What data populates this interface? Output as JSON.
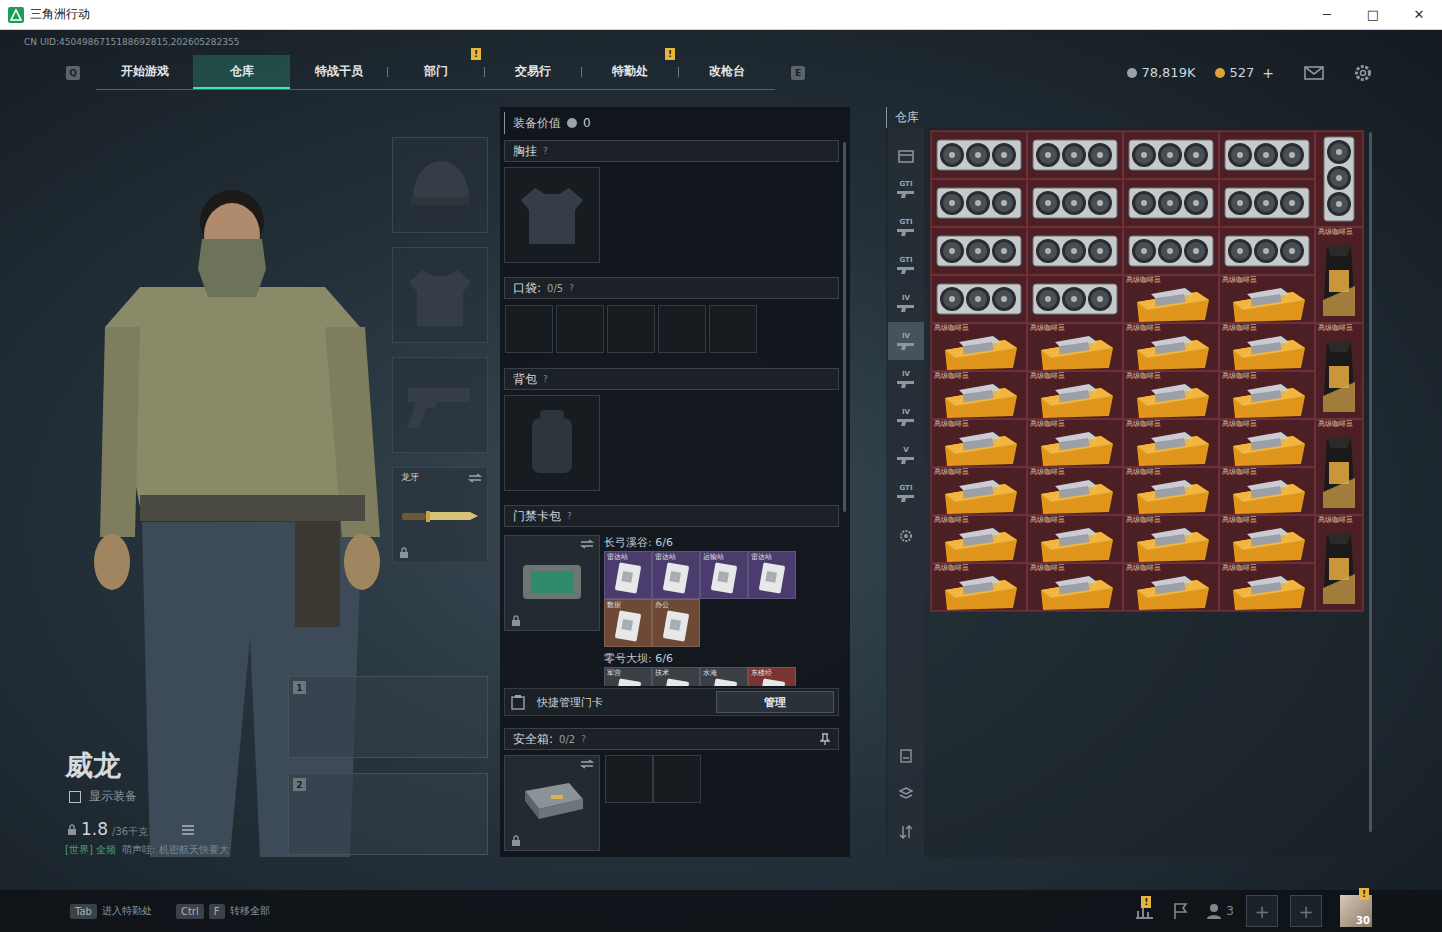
{
  "window": {
    "title": "三角洲行动",
    "controls": [
      "─",
      "□",
      "✕"
    ]
  },
  "uid": "CN UID:4504986715188692815,202605282355",
  "nav": {
    "prev_key": "Q",
    "next_key": "E",
    "tabs": [
      {
        "label": "开始游戏",
        "selected": false,
        "badge": ""
      },
      {
        "label": "仓库",
        "selected": true,
        "badge": ""
      },
      {
        "label": "特战干员",
        "selected": false,
        "badge": ""
      },
      {
        "label": "部门",
        "selected": false,
        "badge": "!"
      },
      {
        "label": "交易行",
        "selected": false,
        "badge": ""
      },
      {
        "label": "特勤处",
        "selected": false,
        "badge": "!"
      },
      {
        "label": "改枪台",
        "selected": false,
        "badge": ""
      }
    ],
    "currencies": [
      {
        "value": "78,819K",
        "add": "",
        "color": "#9aa3aa"
      },
      {
        "value": "527",
        "add": "+",
        "color": "#d9a53a"
      }
    ]
  },
  "character": {
    "name": "威龙",
    "show_equipment": {
      "label": "显示装备",
      "checked": false
    },
    "weight": {
      "value": "1.8",
      "max": "/36千克"
    },
    "chat": {
      "channel": "[世界] 全频",
      "message": "萌声哇: 机密航天快要大"
    }
  },
  "gear_slots": [
    {
      "kind": "helmet",
      "label": "",
      "locked": false
    },
    {
      "kind": "armor",
      "label": "",
      "locked": false
    },
    {
      "kind": "pistol",
      "label": "",
      "locked": false
    },
    {
      "kind": "melee",
      "label": "龙牙",
      "locked": true
    }
  ],
  "weapon_slots": [
    {
      "number": "1"
    },
    {
      "number": "2"
    }
  ],
  "loadout": {
    "value_label": "装备价值",
    "value": "0",
    "chest": {
      "label": "胸挂",
      "help": "?"
    },
    "pockets": {
      "label": "口袋:",
      "count": "0/5",
      "help": "?",
      "slots": 5
    },
    "backpack": {
      "label": "背包",
      "help": "?"
    },
    "keycards": {
      "label": "门禁卡包",
      "help": "?",
      "locked": true,
      "groups": [
        {
          "title": "长弓溪谷: 6/6",
          "cards": [
            {
              "label": "雷达站",
              "color": "#4b3c6e"
            },
            {
              "label": "雷达站",
              "color": "#4b3c6e"
            },
            {
              "label": "运输站",
              "color": "#4b3c6e"
            },
            {
              "label": "雷达站",
              "color": "#4b3c6e"
            },
            {
              "label": "数据",
              "color": "#6e4a36"
            },
            {
              "label": "办公",
              "color": "#6e4a36"
            }
          ]
        },
        {
          "title": "零号大坝: 6/6",
          "cards": [
            {
              "label": "军营",
              "color": "#3a3f46"
            },
            {
              "label": "技术",
              "color": "#3a3f46"
            },
            {
              "label": "水淹",
              "color": "#3a3f46"
            },
            {
              "label": "东楼经",
              "color": "#7a3434"
            }
          ]
        }
      ],
      "quick": {
        "label": "快捷管理门卡",
        "button": "管理"
      }
    },
    "safe": {
      "label": "安全箱:",
      "count": "0/2",
      "help": "?",
      "locked": true,
      "slots": 2
    }
  },
  "warehouse": {
    "title": "仓库",
    "tabs": [
      {
        "kind": "box",
        "label": "",
        "selected": false
      },
      {
        "kind": "gun",
        "label": "GTI",
        "selected": false
      },
      {
        "kind": "gun",
        "label": "GTI",
        "selected": false
      },
      {
        "kind": "gun",
        "label": "GTI",
        "selected": false
      },
      {
        "kind": "gun",
        "label": "IV",
        "selected": false
      },
      {
        "kind": "gun",
        "label": "IV",
        "selected": true
      },
      {
        "kind": "gun",
        "label": "IV",
        "selected": false
      },
      {
        "kind": "gun",
        "label": "IV",
        "selected": false
      },
      {
        "kind": "gun",
        "label": "V",
        "selected": false
      },
      {
        "kind": "gun",
        "label": "GTI",
        "selected": false
      },
      {
        "kind": "gear",
        "label": "",
        "selected": false
      }
    ],
    "bottom_tabs": [
      {
        "kind": "sort",
        "selected": false
      },
      {
        "kind": "layers",
        "selected": false
      },
      {
        "kind": "transfer",
        "selected": false
      }
    ],
    "items": [
      {
        "kind": "gpu",
        "label": ""
      },
      {
        "kind": "gpu",
        "label": ""
      },
      {
        "kind": "gpu",
        "label": ""
      },
      {
        "kind": "gpu",
        "label": ""
      },
      {
        "kind": "gpu-vertical",
        "label": ""
      },
      {
        "kind": "gpu",
        "label": ""
      },
      {
        "kind": "gpu",
        "label": ""
      },
      {
        "kind": "gpu",
        "label": ""
      },
      {
        "kind": "gpu",
        "label": ""
      },
      {
        "kind": "gpu",
        "label": ""
      },
      {
        "kind": "gpu",
        "label": ""
      },
      {
        "kind": "gpu",
        "label": ""
      },
      {
        "kind": "gpu",
        "label": ""
      },
      {
        "kind": "bag",
        "label": "高级咖啡豆"
      },
      {
        "kind": "gpu",
        "label": ""
      },
      {
        "kind": "gpu",
        "label": ""
      },
      {
        "kind": "wide",
        "label": "高级咖啡豆"
      },
      {
        "kind": "wide",
        "label": "高级咖啡豆"
      },
      {
        "kind": "wide",
        "label": "高级咖啡豆"
      },
      {
        "kind": "wide",
        "label": "高级咖啡豆"
      },
      {
        "kind": "wide",
        "label": "高级咖啡豆"
      },
      {
        "kind": "wide",
        "label": "高级咖啡豆"
      },
      {
        "kind": "bag",
        "label": "高级咖啡豆"
      },
      {
        "kind": "wide",
        "label": "高级咖啡豆"
      },
      {
        "kind": "wide",
        "label": "高级咖啡豆"
      },
      {
        "kind": "wide",
        "label": "高级咖啡豆"
      },
      {
        "kind": "wide",
        "label": "高级咖啡豆"
      },
      {
        "kind": "wide",
        "label": "高级咖啡豆"
      },
      {
        "kind": "wide",
        "label": "高级咖啡豆"
      },
      {
        "kind": "wide",
        "label": "高级咖啡豆"
      },
      {
        "kind": "wide",
        "label": "高级咖啡豆"
      },
      {
        "kind": "bag",
        "label": "高级咖啡豆"
      },
      {
        "kind": "wide",
        "label": "高级咖啡豆"
      },
      {
        "kind": "wide",
        "label": "高级咖啡豆"
      },
      {
        "kind": "wide",
        "label": "高级咖啡豆"
      },
      {
        "kind": "wide",
        "label": "高级咖啡豆"
      },
      {
        "kind": "wide",
        "label": "高级咖啡豆"
      },
      {
        "kind": "wide",
        "label": "高级咖啡豆"
      },
      {
        "kind": "wide",
        "label": "高级咖啡豆"
      },
      {
        "kind": "wide",
        "label": "高级咖啡豆"
      },
      {
        "kind": "bag",
        "label": "高级咖啡豆"
      },
      {
        "kind": "wide",
        "label": "高级咖啡豆"
      },
      {
        "kind": "wide",
        "label": "高级咖啡豆"
      },
      {
        "kind": "wide",
        "label": "高级咖啡豆"
      },
      {
        "kind": "wide",
        "label": "高级咖啡豆"
      }
    ]
  },
  "bottom_bar": {
    "hints": [
      {
        "keys": [
          "Tab"
        ],
        "label": "进入特勤处"
      },
      {
        "keys": [
          "Ctrl",
          "F"
        ],
        "label": "转移全部"
      }
    ],
    "tray": {
      "stats_badge": "!",
      "friends": "3",
      "slots": [
        "+",
        "+"
      ],
      "avatar_level": "30",
      "avatar_badge": "!"
    }
  }
}
